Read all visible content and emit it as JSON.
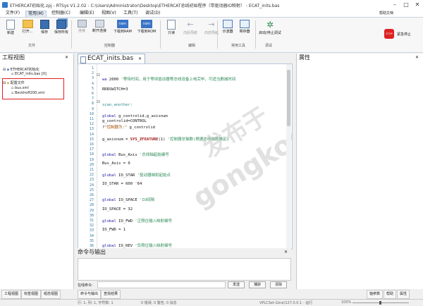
{
  "window": {
    "title": "ETHERCAT初始化.zpj - RTSys V1.2.02 - C:\\Users\\Administrator\\Desktop\\ETHERCAT总线初始程序（带驱动器IO映射） - ECAT_inits.bas",
    "quick_toolbar": [
      "保存",
      "撤销",
      "重做"
    ],
    "right_label": "帮助文档"
  },
  "menu": [
    "文件(F)",
    "常用(M)",
    "控制器(C)",
    "编辑(E)",
    "视图(V)",
    "工具(T)",
    "调试(D)"
  ],
  "ribbon": {
    "file_buttons": [
      "新建",
      "打开...",
      "保存",
      "保存所有"
    ],
    "controller_buttons": [
      "连接",
      "断开连接",
      "下载到RAM",
      "下载到ROM"
    ],
    "edit_buttons": [
      "只读",
      "向后导航",
      "向前导航"
    ],
    "tools_buttons": [
      "示波器",
      "寄存器"
    ],
    "debug_buttons": [
      "启动/停止调试"
    ],
    "estop_label": "紧急停止",
    "groups": [
      "文件",
      "控制器",
      "编辑",
      "常用工具",
      "调试"
    ]
  },
  "left_panel": {
    "title": "工程视图",
    "tree": [
      {
        "label": "ETHERCAT初始化",
        "level": 0
      },
      {
        "label": "ECAT_inits.bas [0]",
        "level": 1
      },
      {
        "label": "配置文件",
        "level": 0
      },
      {
        "label": "bus.xml",
        "level": 1
      },
      {
        "label": "Beckhoff200.xml",
        "level": 1
      }
    ]
  },
  "editor": {
    "tab_label": "ECAT_inits.bas",
    "line_numbers": [
      "1",
      "2",
      "3",
      "4",
      "5",
      "6",
      "7",
      "8",
      "9",
      "10",
      "11",
      "12",
      "13",
      "14",
      "15",
      "16",
      "17",
      "18",
      "19",
      "20",
      "21",
      "22",
      "23",
      "24",
      "25",
      "26",
      "27",
      "28",
      "29",
      "30",
      "31",
      "32",
      "33",
      "34",
      "35",
      "36",
      "37",
      "38",
      "39",
      "40",
      "41",
      "42",
      "43",
      "44",
      "45",
      "46",
      "47",
      "48",
      "49"
    ],
    "lines": [
      {
        "text": "wa 2000    '等待时间，用于等待驱动器等总线设备上电完毕，可适当删减时间",
        "row": 2
      },
      {
        "text": "RRRSWITCH=3",
        "row": 4
      },
      {
        "text": "scan_another:",
        "row": 7
      },
      {
        "text": "global g_controlid,g_axisnum",
        "row": 9
      },
      {
        "text": "g_controlid=CONTROL",
        "row": 10
      },
      {
        "text": "?\"控制器为:\" g_controlid",
        "row": 11
      },
      {
        "text": "g_axisnum = SYS_ZFEATURE(1)    '控制器总轴数(根据总线轴数确定)",
        "row": 14
      },
      {
        "text": "global Bus_Axis  '总线轴起始编号",
        "row": 17
      },
      {
        "text": "Bus_Axis = 0",
        "row": 19
      },
      {
        "text": "global IO_STAR   '驱动器映射起始点",
        "row": 21
      },
      {
        "text": "IO_STAR = 600 '64",
        "row": 23
      },
      {
        "text": "global IO_SPACE  'IO间隔",
        "row": 26
      },
      {
        "text": "IO_SPACE = 32",
        "row": 28
      },
      {
        "text": "global IO_FWD   '正限位输入映射编号",
        "row": 30
      },
      {
        "text": "IO_FWD = 1",
        "row": 32
      },
      {
        "text": "global IO_REV   '负限位输入映射编号",
        "row": 35
      }
    ]
  },
  "right_panel": {
    "title": "属性"
  },
  "output": {
    "title": "命令与输出",
    "command_label": "在线命令:",
    "send_button": "发送",
    "capture_button": "捕获",
    "clear_button": "清除"
  },
  "bottom_tabs_left": [
    "工程视图",
    "标签视图",
    "组态视图"
  ],
  "bottom_tabs_center": [
    "命令与输出",
    "查找结果"
  ],
  "bottom_tabs_right": [
    "轴参数",
    "帮助",
    "属性"
  ],
  "status": {
    "position": "行: 1, 列: 1, 字符数: 1",
    "errors": "0 错误, 0 警告, 0 消息",
    "connection": "VPLCSet-Gine(127.0.0.1 - 运行",
    "zoom": "100%"
  },
  "watermark": "gongkong",
  "colors": {
    "accent": "#2e6db4",
    "keyword": "#1a1aa6",
    "comment": "#2e8b57",
    "highlight_box": "#e02020"
  }
}
